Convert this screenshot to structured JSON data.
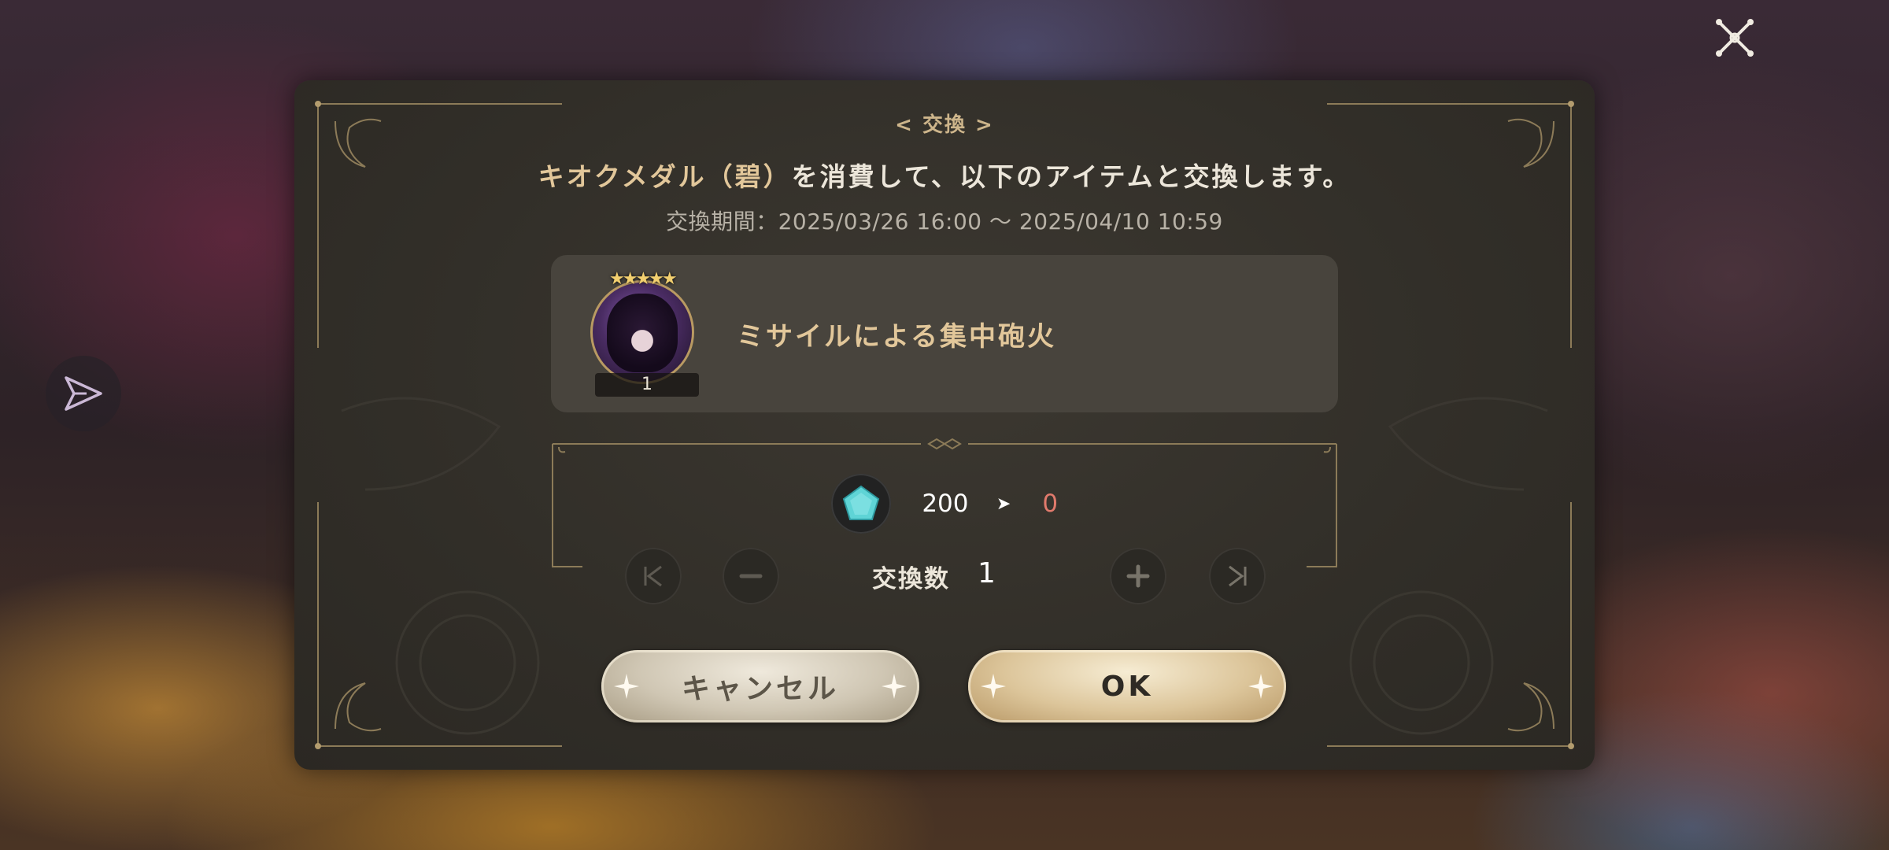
{
  "dialog": {
    "title": "< 交換 >",
    "message_highlight": "キオクメダル（碧）",
    "message_rest": "を消費して、以下のアイテムと交換します。",
    "period": "交換期間：2025/03/26 16:00 ～ 2025/04/10 10:59"
  },
  "item": {
    "name": "ミサイルによる集中砲火",
    "count": "1",
    "stars": "★★★★★"
  },
  "cost": {
    "before": "200",
    "after": "0"
  },
  "quantity": {
    "label": "交換数",
    "value": "1"
  },
  "buttons": {
    "cancel_label": "キャンセル",
    "ok_label": "OK"
  },
  "colors": {
    "accent_gold": "#e2c79a",
    "cost_after_red": "#e07a6c",
    "gem_teal": "#5fd4d6"
  },
  "icons": [
    "close-icon",
    "share-icon",
    "gem-icon",
    "skip-first-icon",
    "minus-icon",
    "plus-icon",
    "skip-last-icon"
  ]
}
